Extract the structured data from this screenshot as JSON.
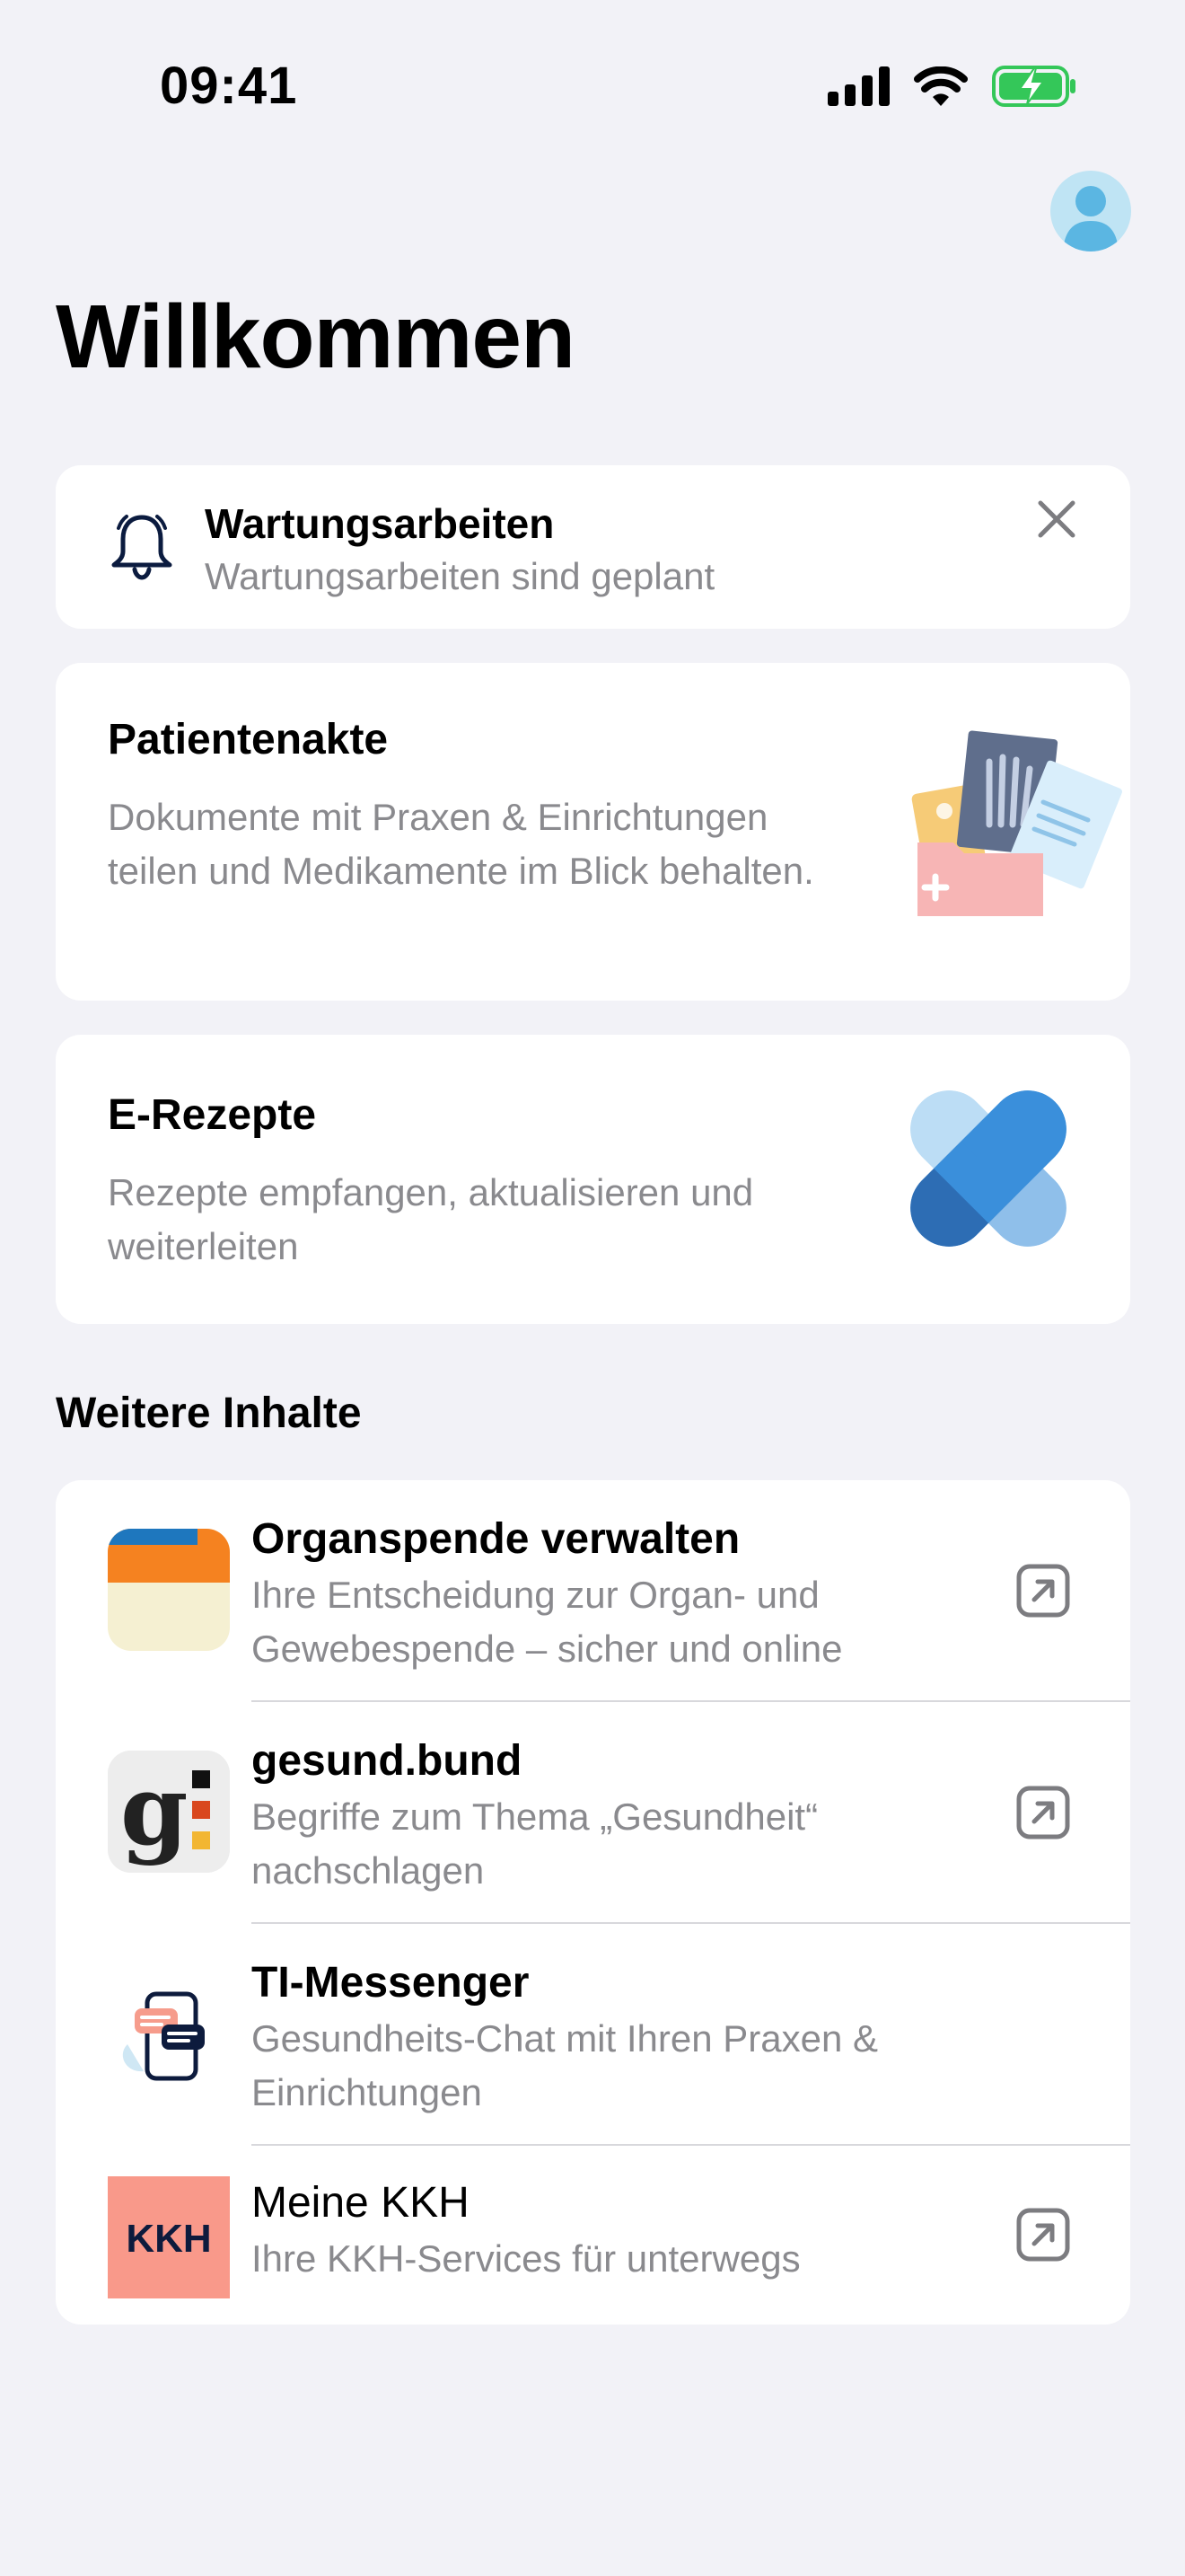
{
  "status_bar": {
    "time": "09:41"
  },
  "header": {
    "title": "Willkommen"
  },
  "notice": {
    "title": "Wartungsarbeiten",
    "subtitle": "Wartungsarbeiten sind geplant"
  },
  "cards": [
    {
      "title": "Patientenakte",
      "description": "Dokumente mit Praxen & Einrichtungen teilen und Medikamente im Blick behalten."
    },
    {
      "title": "E-Rezepte",
      "description": "Rezepte empfangen, aktualisieren und weiterleiten"
    }
  ],
  "more_section": {
    "title": "Weitere Inhalte",
    "items": [
      {
        "title": "Organspende verwalten",
        "description": "Ihre Entscheidung zur Organ- und Gewebespende – sicher und online",
        "external": true
      },
      {
        "title": "gesund.bund",
        "description": "Begriffe zum Thema „Gesundheit“ nachschlagen",
        "external": true
      },
      {
        "title": "TI-Messenger",
        "description": "Gesundheits-Chat mit Ihren Praxen & Einrichtungen",
        "external": false
      },
      {
        "title": "Meine KKH",
        "description": "Ihre KKH-Services für unterwegs",
        "external": true,
        "logo_text": "KKH"
      }
    ]
  },
  "colors": {
    "background": "#F2F2F7",
    "card": "#FFFFFF",
    "secondary_text": "#8A8A8E",
    "battery": "#34C759",
    "accent_blue": "#3B8EDB",
    "kkh_brand": "#F9998A"
  }
}
